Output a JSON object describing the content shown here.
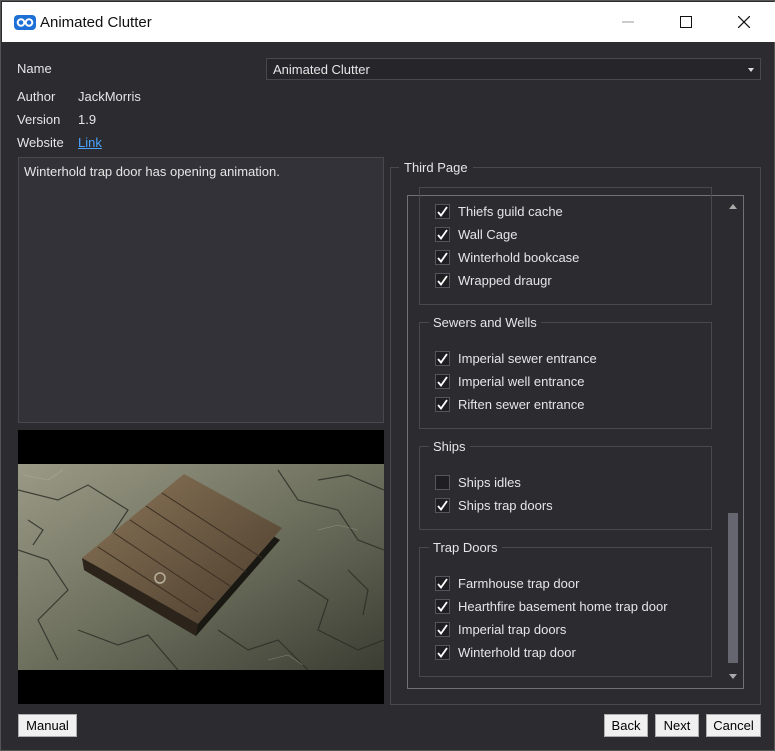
{
  "window": {
    "title": "Animated Clutter"
  },
  "info": {
    "name_label": "Name",
    "name_value": "Animated Clutter",
    "author_label": "Author",
    "author_value": "JackMorris",
    "version_label": "Version",
    "version_value": "1.9",
    "website_label": "Website",
    "website_value": "Link"
  },
  "description": "Winterhold trap door has opening animation.",
  "page": {
    "title": "Third Page",
    "groups": [
      {
        "title": "",
        "items": [
          {
            "label": "Thiefs guild cache",
            "checked": true
          },
          {
            "label": "Wall Cage",
            "checked": true
          },
          {
            "label": "Winterhold bookcase",
            "checked": true
          },
          {
            "label": "Wrapped draugr",
            "checked": true
          }
        ]
      },
      {
        "title": "Sewers and Wells",
        "items": [
          {
            "label": "Imperial sewer entrance",
            "checked": true
          },
          {
            "label": "Imperial well entrance",
            "checked": true
          },
          {
            "label": "Riften sewer entrance",
            "checked": true
          }
        ]
      },
      {
        "title": "Ships",
        "items": [
          {
            "label": "Ships idles",
            "checked": false
          },
          {
            "label": "Ships trap doors",
            "checked": true
          }
        ]
      },
      {
        "title": "Trap Doors",
        "items": [
          {
            "label": "Farmhouse trap door",
            "checked": true
          },
          {
            "label": "Hearthfire basement home trap door",
            "checked": true
          },
          {
            "label": "Imperial trap doors",
            "checked": true
          },
          {
            "label": "Winterhold trap door",
            "checked": true
          }
        ]
      }
    ]
  },
  "buttons": {
    "manual": "Manual",
    "back": "Back",
    "next": "Next",
    "cancel": "Cancel"
  },
  "colors": {
    "background": "#2b2b30",
    "link": "#4aa3ff",
    "titlebar": "#ffffff"
  }
}
